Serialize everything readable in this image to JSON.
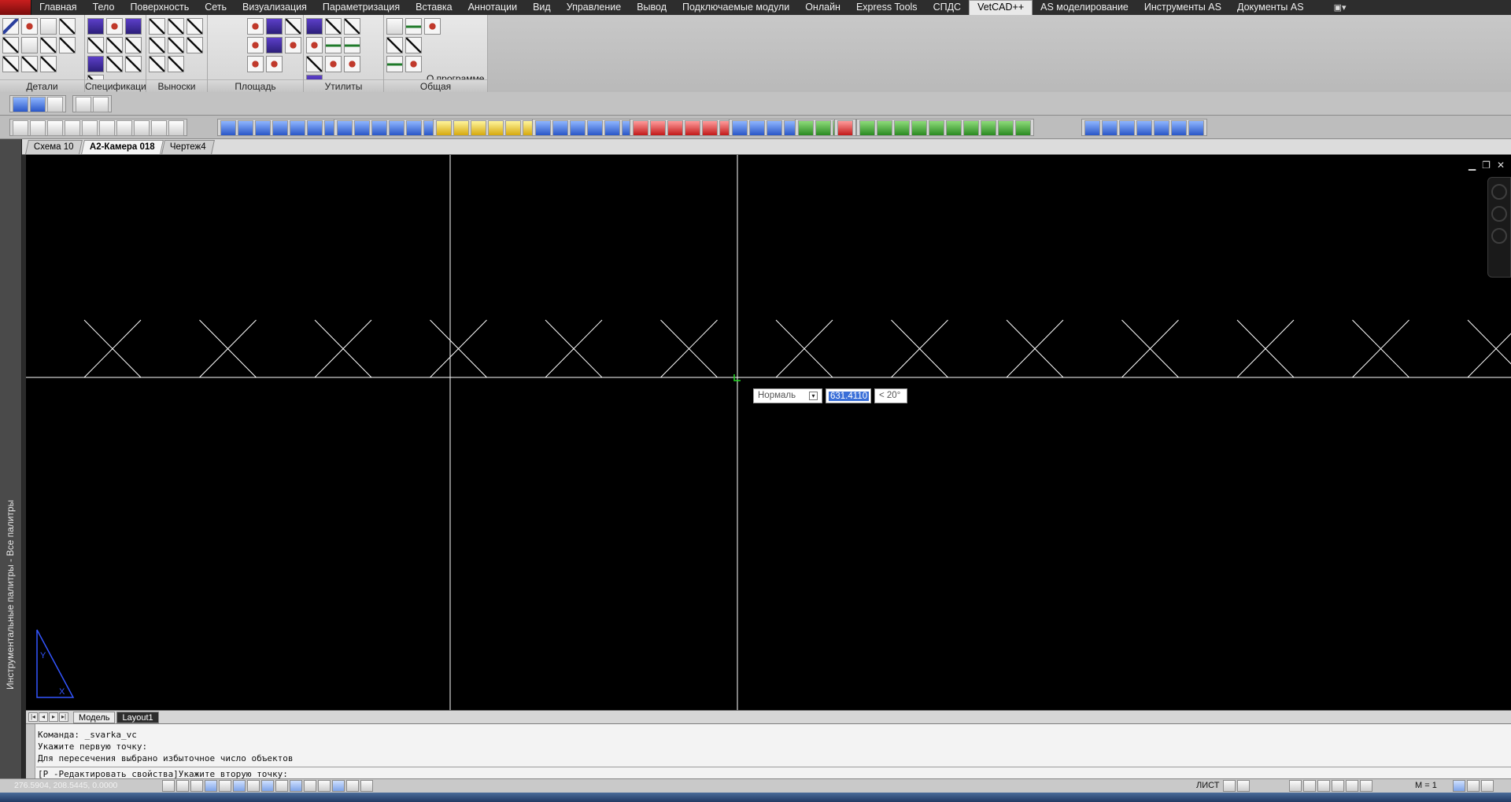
{
  "menubar": {
    "items": [
      "Главная",
      "Тело",
      "Поверхность",
      "Сеть",
      "Визуализация",
      "Параметризация",
      "Вставка",
      "Аннотации",
      "Вид",
      "Управление",
      "Вывод",
      "Подключаемые модули",
      "Онлайн",
      "Express Tools",
      "СПДС",
      "VetCAD++",
      "AS моделирование",
      "Инструменты AS",
      "Документы AS"
    ],
    "active_index": 15,
    "extra_icon": "camera-dropdown-icon"
  },
  "ribbon": {
    "panels": [
      {
        "title": "Детали оформления"
      },
      {
        "title": "Спецификации"
      },
      {
        "title": "Выноски"
      },
      {
        "title": "Площадь"
      },
      {
        "title": "Утилиты"
      },
      {
        "title": "Общая"
      }
    ],
    "about_label": "О программе"
  },
  "doc_tabs": [
    "Схема 10",
    "А2-Камера 018",
    "Чертеж4"
  ],
  "active_doc_tab": 1,
  "palette_title": "Инструментальные палитры - Все палитры",
  "canvas": {
    "background": "#000000",
    "ucs_axis_y": "Y",
    "ucs_axis_x": "X"
  },
  "dynamic_input": {
    "mode": "Нормаль",
    "value": "631.4110",
    "angle": "< 20°"
  },
  "layout_tabs": [
    "Модель",
    "Layout1"
  ],
  "active_layout_tab": 1,
  "command_line": {
    "history": [
      "Команда: _svarka_vc",
      "Укажите первую точку:",
      "Для пересечения выбрано избыточное число объектов"
    ],
    "input": "[P -Редактировать свойства]Укажите вторую точку:"
  },
  "statusbar": {
    "coords": "276.5904, 208.5445, 0.0000",
    "sheet_label": "ЛИСТ",
    "scale_label": "M = 1"
  }
}
